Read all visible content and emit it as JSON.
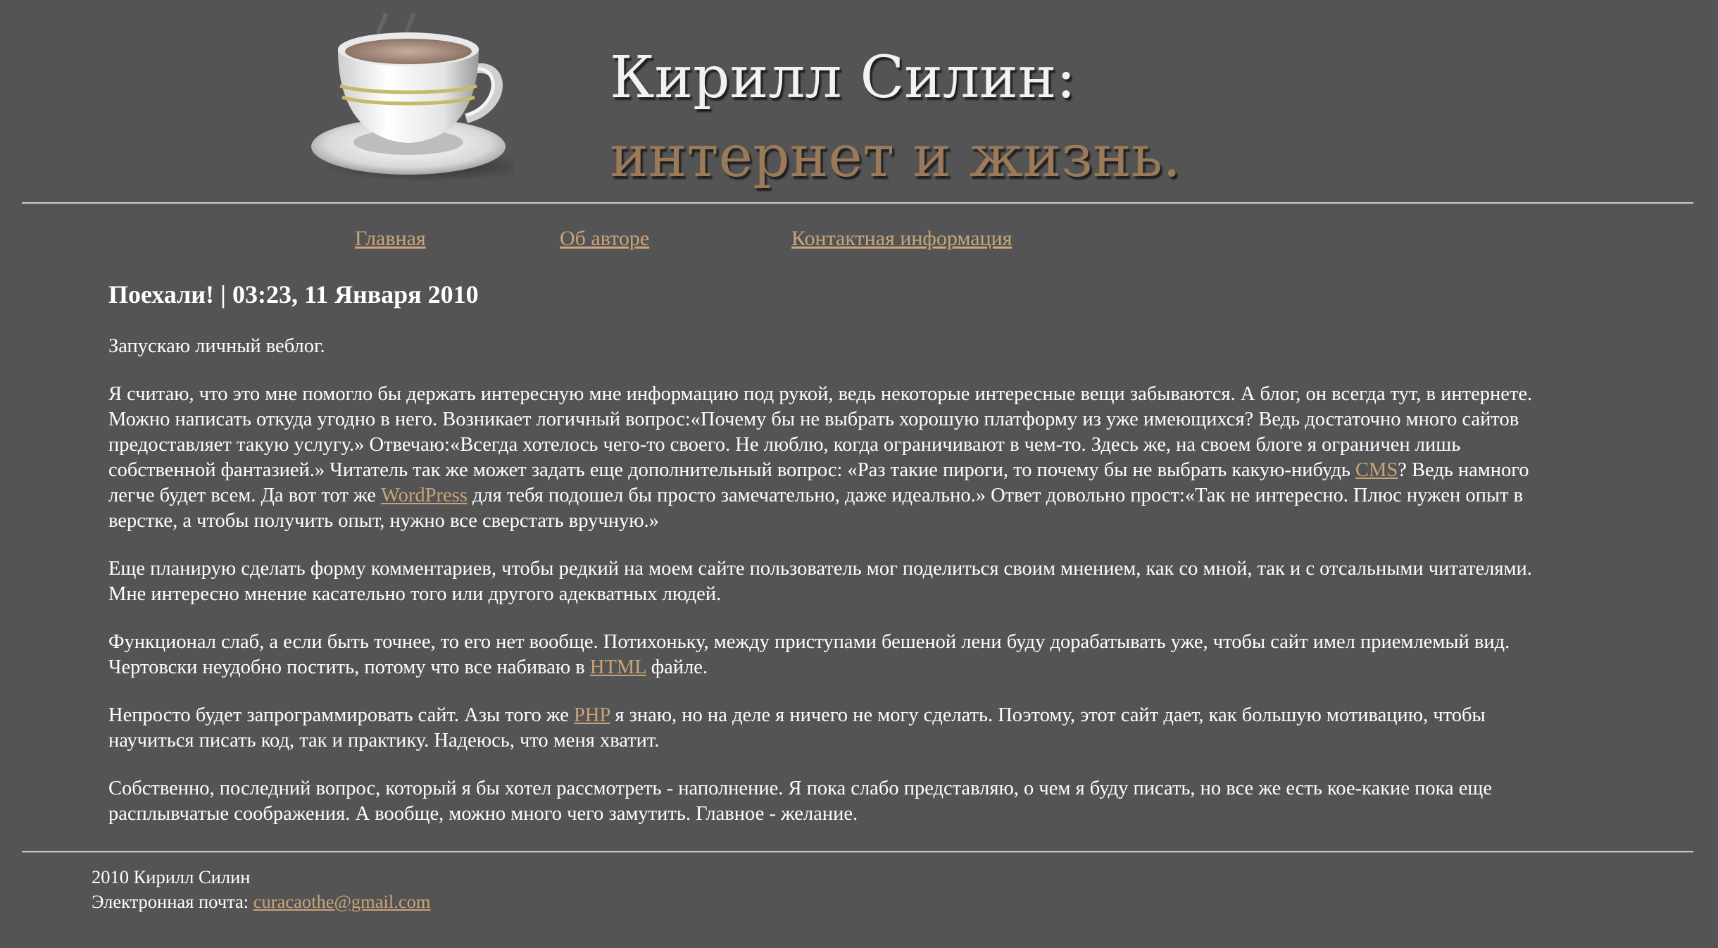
{
  "header": {
    "title_line1": "Кирилл Силин:",
    "title_line2": "интернет и жизнь.",
    "logo_icon": "coffee-cup-icon"
  },
  "nav": {
    "items": [
      {
        "label": "Главная"
      },
      {
        "label": "Об авторе"
      },
      {
        "label": "Контактная информация"
      }
    ]
  },
  "post": {
    "heading": "Поехали! | 03:23, 11 Января 2010",
    "p1": "Запускаю личный веблог.",
    "p2": {
      "a": "Я считаю, что это мне помогло бы держать интересную мне информацию под рукой, ведь некоторые интересные вещи забываются. А блог, он всегда тут, в интернете. Можно написать откуда угодно в него. Возникает логичный вопрос:«Почему бы не выбрать хорошую платформу из уже имеющихся? Ведь достаточно много сайтов предоставляет такую услугу.» Отвечаю:«Всегда хотелось чего-то своего. Не люблю, когда ограничивают в чем-то. Здесь же, на своем блоге я ограничен лишь собственной фантазией.» Читатель так же может задать еще дополнительный вопрос: «Раз такие пироги, то почему бы не выбрать какую-нибудь ",
      "link_cms": "CMS",
      "b": "? Ведь намного легче будет всем. Да вот тот же ",
      "link_wordpress": "WordPress",
      "c": " для тебя подошел бы просто замечательно, даже идеально.» Ответ довольно прост:«Так не интересно. Плюс нужен опыт в верстке, а чтобы получить опыт, нужно все сверстать вручную.»"
    },
    "p3": "Еще планирую сделать форму комментариев, чтобы редкий на моем сайте пользователь мог поделиться своим мнением, как со мной, так и с отсальными читателями. Мне интересно мнение касательно того или другого адекватных людей.",
    "p4": {
      "a": "Функционал слаб, а если быть точнее, то его нет вообще. Потихоньку, между приступами бешеной лени буду дорабатывать уже, чтобы сайт имел приемлемый вид. Чертовски неудобно постить, потому что все набиваю в ",
      "link_html": "HTML",
      "b": " файле."
    },
    "p5": {
      "a": "Непросто будет запрограммировать сайт. Азы того же ",
      "link_php": "PHP",
      "b": " я знаю, но на деле я ничего не могу сделать. Поэтому, этот сайт дает, как большую мотивацию, чтобы научиться писать код, так и практику. Надеюсь, что меня хватит."
    },
    "p6": "Собственно, последний вопрос, который я бы хотел рассмотреть - наполнение. Я пока слабо представляю, о чем я буду писать, но все же есть кое-какие пока еще расплывчатые соображения. А вообще, можно много чего замутить. Главное - желание."
  },
  "footer": {
    "copyright": "2010 Кирилл Силин",
    "email_label": "Электронная почта: ",
    "email": "curacaothe@gmail.com"
  },
  "colors": {
    "background": "#545454",
    "link": "#c9a47a",
    "title_accent": "#9a7a58",
    "text": "#ffffff"
  }
}
